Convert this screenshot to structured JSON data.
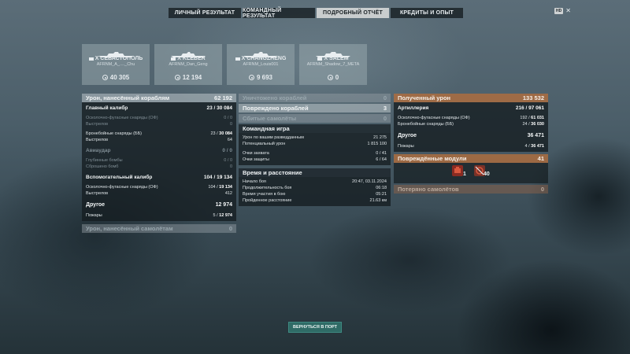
{
  "tabs": [
    {
      "label": "ЛИЧНЫЙ РЕЗУЛЬТАТ",
      "active": false
    },
    {
      "label": "КОМАНДНЫЙ РЕЗУЛЬТАТ",
      "active": false
    },
    {
      "label": "ПОДРОБНЫЙ ОТЧЁТ",
      "active": true
    },
    {
      "label": "КРЕДИТЫ И ОПЫТ",
      "active": false
    }
  ],
  "hd_badge": "HD",
  "close_glyph": "✕",
  "ships": [
    {
      "name": "X СЕВАСТОПОЛЬ",
      "player": "AFRNM_A_...._Chu",
      "damage": "40 305"
    },
    {
      "name": "X KLÉBER",
      "player": "AFRNM_Dan_Geng",
      "damage": "12 194"
    },
    {
      "name": "X CHANGZHENG",
      "player": "AFRNM_Louis001",
      "damage": "9 693"
    },
    {
      "name": "X SALEM",
      "player": "AFRNM_Shadow_7_META",
      "damage": "0"
    }
  ],
  "col1": {
    "ship_damage": {
      "label": "Урон, нанесённый кораблям",
      "value": "62 192"
    },
    "main_battery": {
      "label": "Главный калибр",
      "value_a": "23",
      "value_b": "30 084"
    },
    "he_shells": {
      "label": "Осколочно-фугасные снаряды (ОФ)",
      "value": "0 / 0"
    },
    "he_shots": {
      "label": "Выстрелов",
      "value": "0"
    },
    "ap_shells": {
      "label": "Бронебойные снаряды (ББ)",
      "value_a": "23",
      "value_b": "30 084"
    },
    "ap_shots": {
      "label": "Выстрелов",
      "value": "64"
    },
    "aircraft": {
      "label": "Авиаудар",
      "value": "0 / 0"
    },
    "depth_charges": {
      "label": "Глубинные бомбы",
      "value": "0 / 0"
    },
    "bombs_dropped": {
      "label": "Сброшено бомб",
      "value": "0"
    },
    "secondary": {
      "label": "Вспомогательный калибр",
      "value_a": "104",
      "value_b": "19 134"
    },
    "sec_he": {
      "label": "Осколочно-фугасные снаряды (ОФ)",
      "value_a": "104",
      "value_b": "19 134"
    },
    "sec_shots": {
      "label": "Выстрелов",
      "value": "412"
    },
    "other": {
      "label": "Другое",
      "value": "12 974"
    },
    "fires": {
      "label": "Пожары",
      "value_a": "5",
      "value_b": "12 974"
    },
    "plane_damage": {
      "label": "Урон, нанесённый самолётам",
      "value": "0"
    }
  },
  "col2": {
    "destroyed": {
      "label": "Уничтожено кораблей",
      "value": "0"
    },
    "damaged": {
      "label": "Повреждено кораблей",
      "value": "3"
    },
    "planes_down": {
      "label": "Сбитые самолёты",
      "value": "0"
    },
    "team_title": "Командная игра",
    "spotting": {
      "label": "Урон по вашим разведданным",
      "value": "21 275"
    },
    "potential": {
      "label": "Потенциальный урон",
      "value": "1 815 100"
    },
    "capture": {
      "label": "Очки захвата",
      "value": "0 / 41"
    },
    "defense": {
      "label": "Очки защиты",
      "value": "6 / 64"
    },
    "time_title": "Время и расстояние",
    "start": {
      "label": "Начало боя",
      "value": "20:47, 03.11.2024"
    },
    "duration": {
      "label": "Продолжительность боя",
      "value": "06:18"
    },
    "time_in": {
      "label": "Время участия в бою",
      "value": "05:21"
    },
    "distance": {
      "label": "Пройденное расстояние",
      "value": "21.63 км"
    }
  },
  "col3": {
    "received": {
      "label": "Полученный урон",
      "value": "133 532"
    },
    "artillery": {
      "label": "Артиллерия",
      "value_a": "216",
      "value_b": "97 061"
    },
    "r_he": {
      "label": "Осколочно-фугасные снаряды (ОФ)",
      "value_a": "192",
      "value_b": "61 031"
    },
    "r_ap": {
      "label": "Бронебойные снаряды (ББ)",
      "value_a": "24",
      "value_b": "36 030"
    },
    "r_other": {
      "label": "Другое",
      "value": "36 471"
    },
    "r_fires": {
      "label": "Пожары",
      "value_a": "4",
      "value_b": "36 471"
    },
    "modules": {
      "label": "Повреждённые модули",
      "value": "41"
    },
    "mod_1_count": "1",
    "mod_2_count": "40",
    "planes_lost": {
      "label": "Потеряно самолётов",
      "value": "0"
    }
  },
  "back_button": "ВЕРНУТЬСЯ В ПОРТ",
  "icons": {
    "ship_silhouette": "ship-silhouette-icon",
    "damage": "damage-icon",
    "module_1": "engine-module-icon",
    "module_2": "steering-module-icon"
  }
}
